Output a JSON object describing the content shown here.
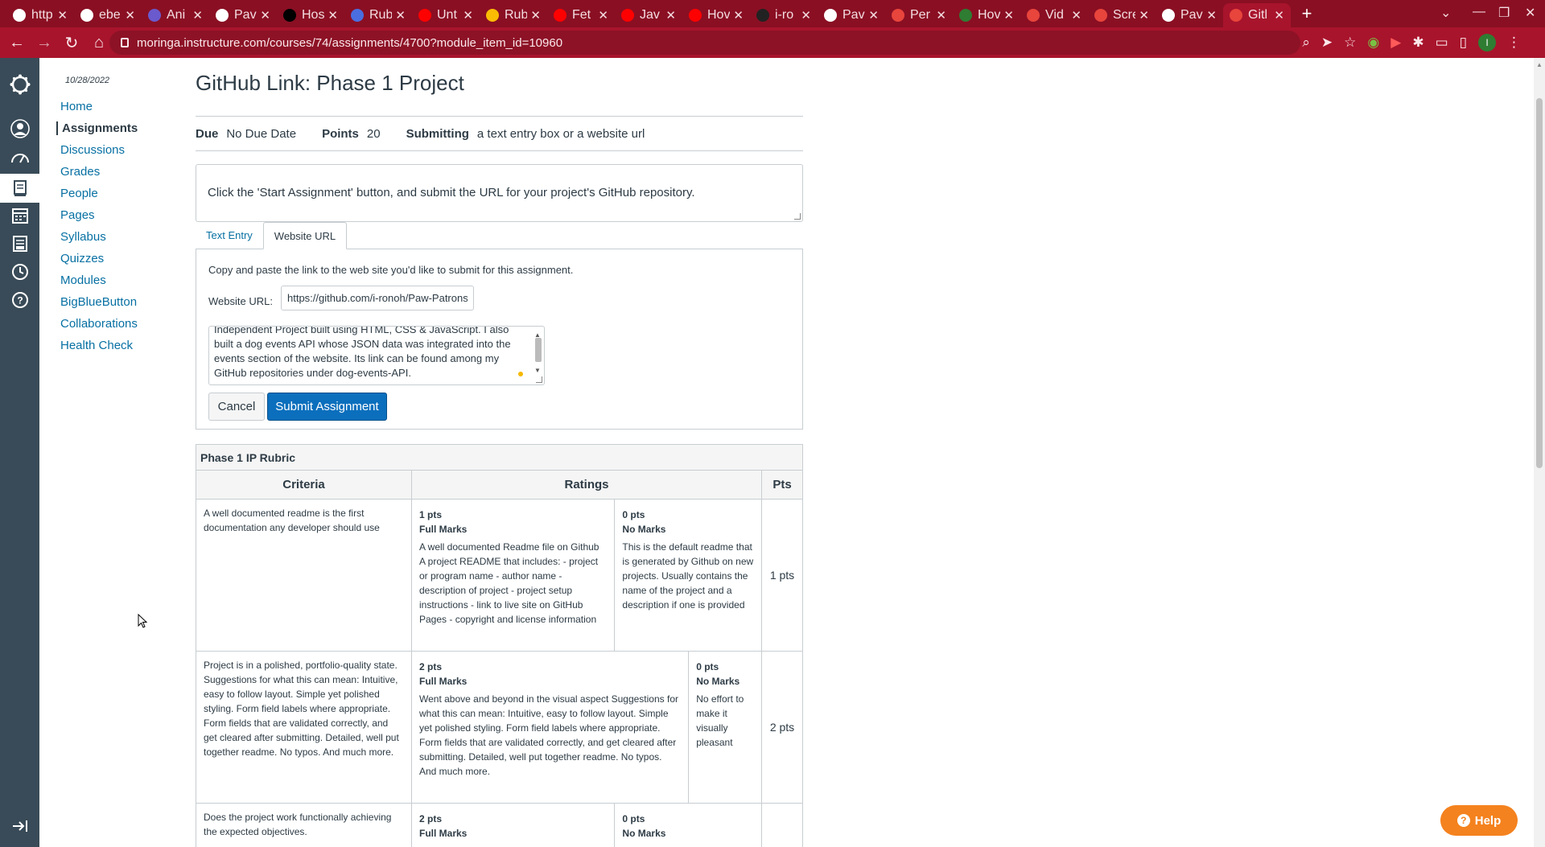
{
  "browser": {
    "tabs": [
      {
        "title": "http",
        "color": "#ffffff"
      },
      {
        "title": "ebe",
        "color": "#ffffff"
      },
      {
        "title": "Ani",
        "color": "#6a5acd"
      },
      {
        "title": "Pav",
        "color": "#ffffff"
      },
      {
        "title": "Hos",
        "color": "#000000"
      },
      {
        "title": "Rub",
        "color": "#4a6ee0"
      },
      {
        "title": "Unt",
        "color": "#ff0000"
      },
      {
        "title": "Rub",
        "color": "#fbbc04"
      },
      {
        "title": "Fet",
        "color": "#ff0000"
      },
      {
        "title": "Jav",
        "color": "#ff0000"
      },
      {
        "title": "Hov",
        "color": "#ff0000"
      },
      {
        "title": "i-ro",
        "color": "#222222"
      },
      {
        "title": "Pav",
        "color": "#ffffff"
      },
      {
        "title": "Per",
        "color": "#e8453c"
      },
      {
        "title": "Hov",
        "color": "#2e7d32"
      },
      {
        "title": "Vid",
        "color": "#e8453c"
      },
      {
        "title": "Scre",
        "color": "#e8453c"
      },
      {
        "title": "Pav",
        "color": "#ffffff"
      },
      {
        "title": "Gitl",
        "color": "#e8453c"
      }
    ],
    "url": "moringa.instructure.com/courses/74/assignments/4700?module_item_id=10960",
    "profile_initial": "I"
  },
  "course_nav": {
    "date": "10/28/2022",
    "items": [
      "Home",
      "Assignments",
      "Discussions",
      "Grades",
      "People",
      "Pages",
      "Syllabus",
      "Quizzes",
      "Modules",
      "BigBlueButton",
      "Collaborations",
      "Health Check"
    ],
    "active_index": 1
  },
  "assignment": {
    "title": "GitHub Link: Phase 1 Project",
    "due_label": "Due",
    "due_value": "No Due Date",
    "points_label": "Points",
    "points_value": "20",
    "submitting_label": "Submitting",
    "submitting_value": "a text entry box or a website url",
    "description": "Click the 'Start Assignment' button, and submit the URL for your project's GitHub repository."
  },
  "submission": {
    "tabs": [
      "Text Entry",
      "Website URL"
    ],
    "active_tab": 1,
    "instructions": "Copy and paste the link to the web site you'd like to submit for this assignment.",
    "url_label": "Website URL:",
    "url_value": "https://github.com/i-ronoh/Paw-Patrons.",
    "comment_text": "Independent Project built using HTML, CSS & JavaScript. I also built a dog events API whose JSON data was integrated into the events section of the website. Its link can be found among my GitHub repositories under dog-events-API.",
    "cancel_label": "Cancel",
    "submit_label": "Submit Assignment"
  },
  "rubric": {
    "title": "Phase 1 IP Rubric",
    "headers": {
      "criteria": "Criteria",
      "ratings": "Ratings",
      "pts": "Pts"
    },
    "rows": [
      {
        "criteria": "A well documented readme is the first documentation any developer should use",
        "ratings": [
          {
            "pts": "1 pts",
            "title": "Full Marks",
            "desc": "A well documented Readme file on Github A project README that includes: - project or program name - author name - description of project - project setup instructions - link to live site on GitHub Pages - copyright and license information"
          },
          {
            "pts": "0 pts",
            "title": "No Marks",
            "desc": "This is the default readme that is generated by Github on new projects. Usually contains the name of the project and a description if one is provided"
          }
        ],
        "total": "1 pts"
      },
      {
        "criteria": "Project is in a polished, portfolio-quality state. Suggestions for what this can mean: Intuitive, easy to follow layout. Simple yet polished styling. Form field labels where appropriate. Form fields that are validated correctly, and get cleared after submitting. Detailed, well put together readme. No typos. And much more.",
        "ratings": [
          {
            "pts": "2 pts",
            "title": "Full Marks",
            "desc": "Went above and beyond in the visual aspect Suggestions for what this can mean: Intuitive, easy to follow layout. Simple yet polished styling. Form field labels where appropriate. Form fields that are validated correctly, and get cleared after submitting. Detailed, well put together readme. No typos. And much more."
          },
          {
            "pts": "0 pts",
            "title": "No Marks",
            "desc": "No effort to make it visually pleasant"
          }
        ],
        "total": "2 pts"
      },
      {
        "criteria": "Does the project work functionally achieving the expected objectives.",
        "ratings": [
          {
            "pts": "2 pts",
            "title": "Full Marks",
            "desc": ""
          },
          {
            "pts": "0 pts",
            "title": "No Marks",
            "desc": ""
          }
        ],
        "total": ""
      }
    ]
  },
  "help_label": "Help"
}
